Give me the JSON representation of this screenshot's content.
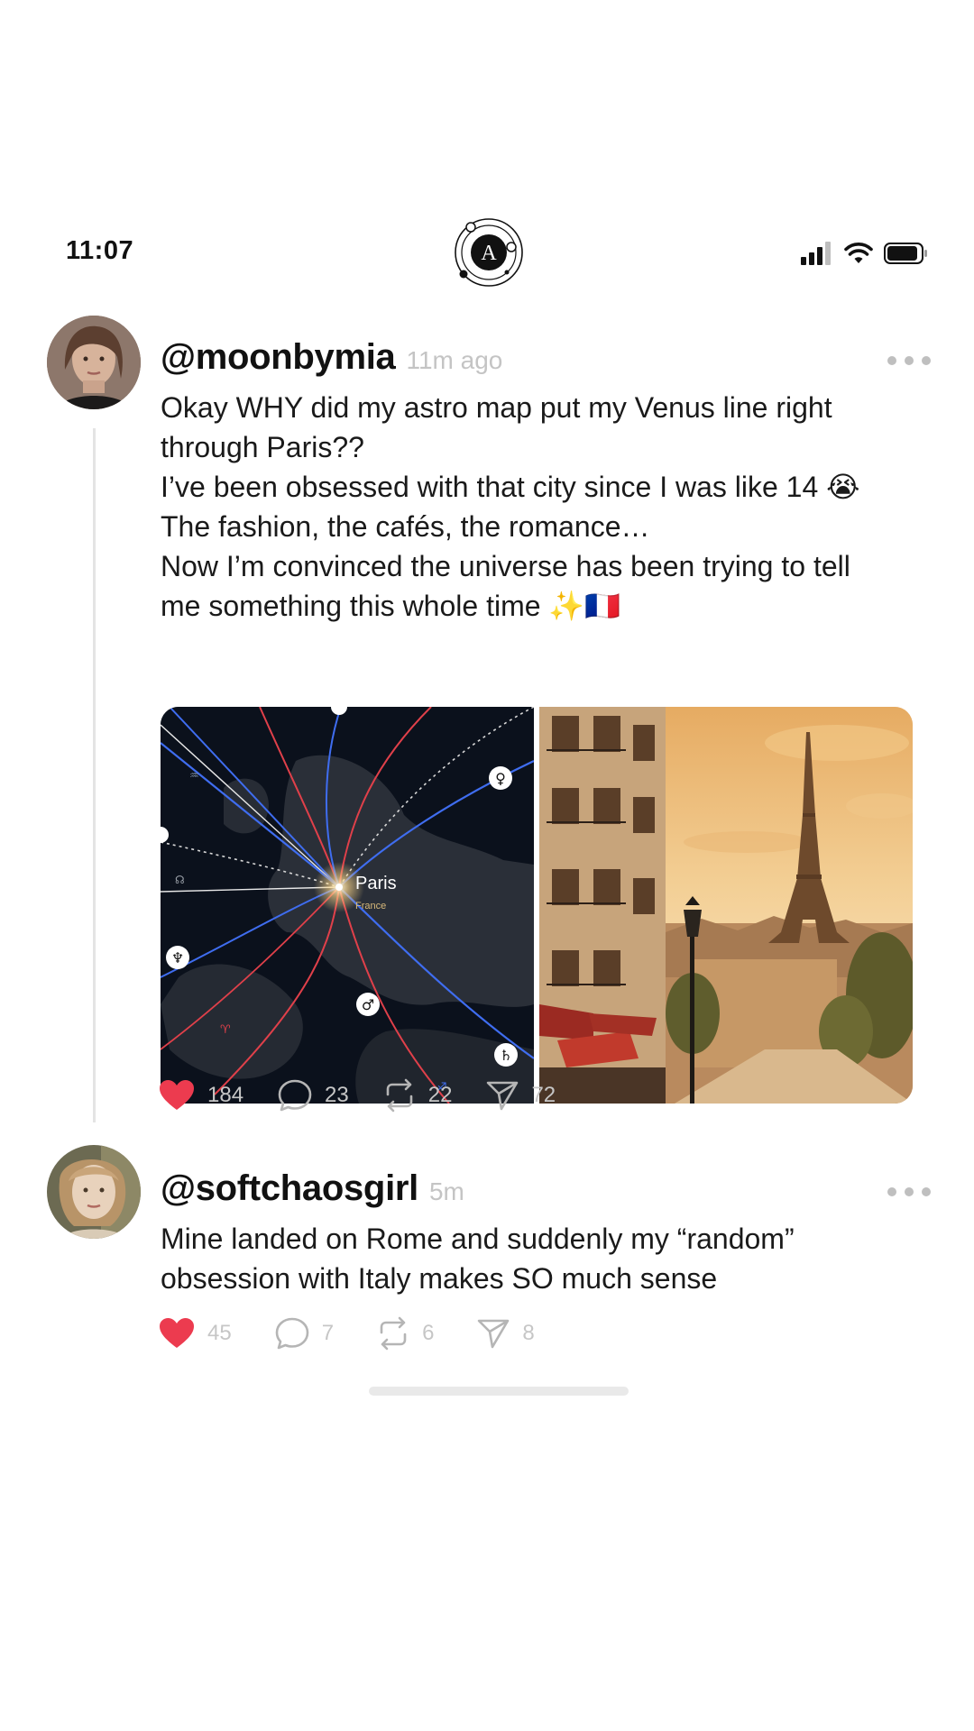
{
  "status_bar": {
    "time": "11:07",
    "app_logo_letter": "A",
    "icons": [
      "signal-icon",
      "wifi-icon",
      "battery-icon"
    ]
  },
  "posts": [
    {
      "handle": "@moonbymia",
      "time_ago": "11m ago",
      "lines": [
        "Okay WHY did my astro map put my Venus line right",
        "through Paris??",
        "I’ve been obsessed with that city since I was like 14 😭",
        "The fashion, the cafés, the romance…",
        "Now I’m convinced the universe has been trying to tell",
        "me something this whole time ✨🇫🇷"
      ],
      "map": {
        "city": "Paris",
        "country": "France"
      },
      "stats": {
        "likes": "184",
        "comments": "23",
        "reposts": "22",
        "shares": "72"
      }
    },
    {
      "handle": "@softchaosgirl",
      "time_ago": "5m",
      "lines": [
        "Mine landed on Rome and suddenly my “random”",
        "obsession with Italy makes SO much sense"
      ],
      "stats": {
        "likes": "45",
        "comments": "7",
        "reposts": "6",
        "shares": "8"
      }
    }
  ],
  "colors": {
    "like": "#ec3b4f",
    "muted": "#c4c4c4",
    "venus_line": "#3f6df0",
    "mars_line": "#e0404a"
  }
}
